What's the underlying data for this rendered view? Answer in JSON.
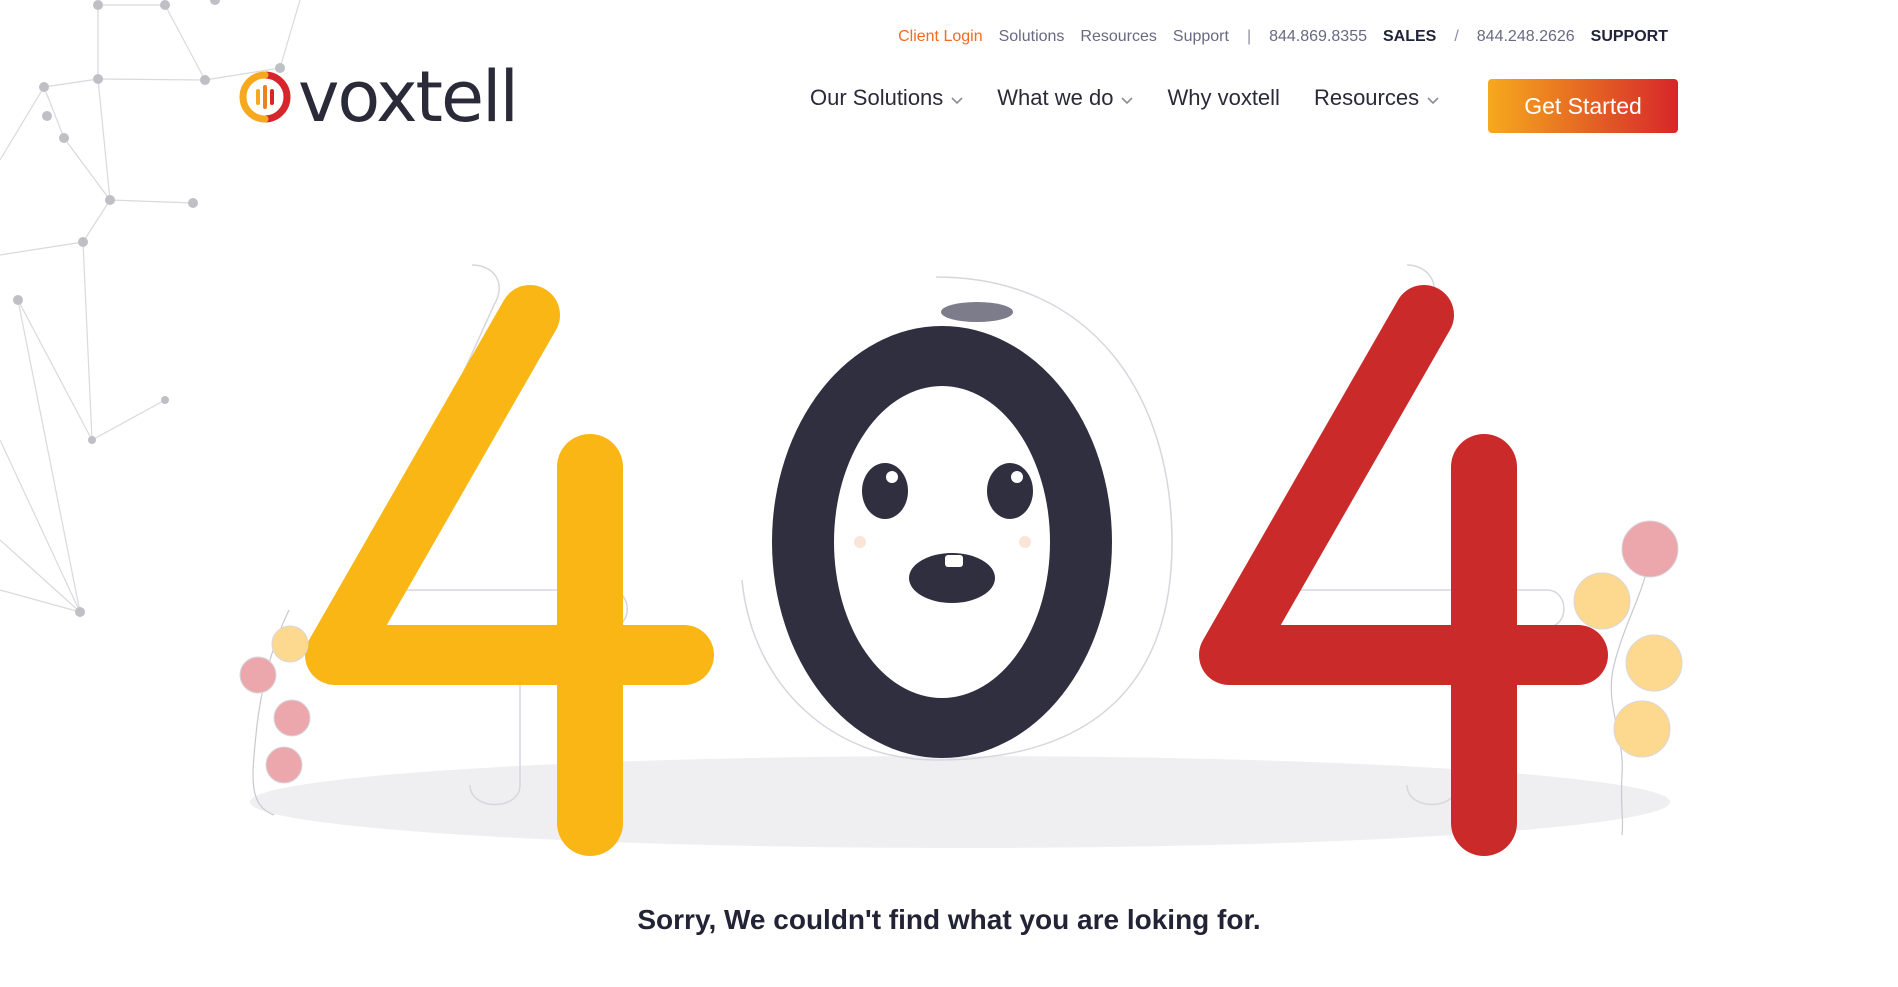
{
  "brand": {
    "name": "voxtell",
    "colors": {
      "orange": "#f26b21",
      "yellow": "#f9b615",
      "red": "#cb2a2b",
      "navy": "#2f2f40"
    },
    "icon": "voxtell-logo-icon"
  },
  "header": {
    "top_links": [
      {
        "label": "Client Login",
        "color": "#f26b21"
      },
      {
        "label": "Solutions"
      },
      {
        "label": "Resources"
      },
      {
        "label": "Support"
      }
    ],
    "separator": "|",
    "sales_phone": "844.869.8355",
    "sales_label": "SALES",
    "slash": "/",
    "support_phone": "844.248.2626",
    "support_label": "SUPPORT",
    "main_nav": [
      {
        "label": "Our Solutions",
        "has_dropdown": true
      },
      {
        "label": "What we do",
        "has_dropdown": true
      },
      {
        "label": "Why voxtell",
        "has_dropdown": false
      },
      {
        "label": "Resources",
        "has_dropdown": true
      }
    ],
    "cta_label": "Get Started"
  },
  "error": {
    "digits": [
      "4",
      "0",
      "4"
    ],
    "message": "Sorry, We couldn't find what you are loking for."
  }
}
